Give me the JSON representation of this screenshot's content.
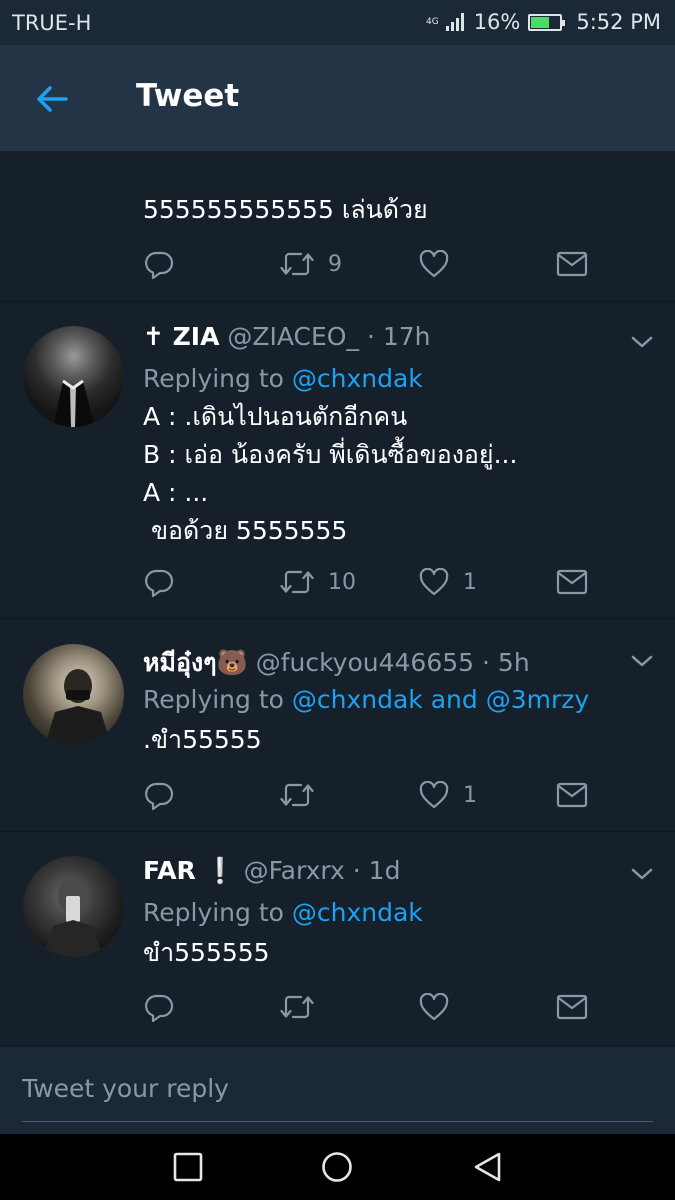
{
  "status_bar": {
    "carrier": "TRUE-H",
    "network": "4G",
    "battery": "16%",
    "time": "5:52 PM"
  },
  "header": {
    "title": "Tweet",
    "back_icon": "back-arrow-icon",
    "accent": "#1da1f2"
  },
  "tweets": [
    {
      "body": "555555555555 เล่นด้วย",
      "replies": "",
      "retweets": "9",
      "likes": ""
    },
    {
      "name": "✝ ZIA",
      "handle": "@ZIACEO_",
      "time": "· 17h",
      "replying_label": "Replying to ",
      "replying_to": "@chxndak",
      "body": "A : .เดินไปนอนตักอีกคน\nB : เอ่อ น้องครับ พี่เดินซื้อของอยู่...\nA : ...\n ขอด้วย 5555555",
      "retweets": "10",
      "likes": "1"
    },
    {
      "name": "หมีอุ๋งๆ🐻",
      "handle": "@fuckyou446655",
      "time": "· 5h",
      "replying_label": "Replying to ",
      "replying_to": "@chxndak and @3mrzy",
      "body": ".ขำ55555",
      "retweets": "",
      "likes": "1"
    },
    {
      "name": "FAR ❕",
      "handle": "@Farxrx",
      "time": "· 1d",
      "replying_label": "Replying to ",
      "replying_to": "@chxndak",
      "body": "ขำ555555",
      "retweets": "",
      "likes": ""
    }
  ],
  "reply_box": {
    "placeholder": "Tweet your reply"
  },
  "colors": {
    "background": "#15202b",
    "header": "#243447",
    "muted": "#8899a6",
    "link": "#1da1f2"
  }
}
